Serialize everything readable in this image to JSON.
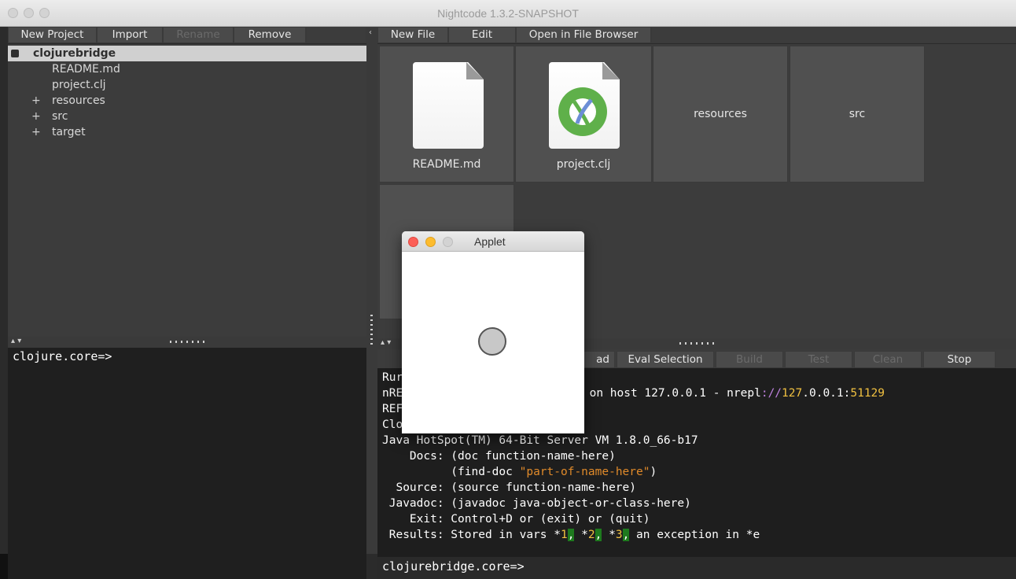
{
  "window": {
    "title": "Nightcode 1.3.2-SNAPSHOT"
  },
  "project_toolbar": {
    "new_project": "New Project",
    "import": "Import",
    "rename": "Rename",
    "remove": "Remove"
  },
  "file_toolbar": {
    "new_file": "New File",
    "edit": "Edit",
    "open_in_file_browser": "Open in File Browser"
  },
  "tree": {
    "root": "clojurebridge",
    "items": [
      "README.md",
      "project.clj",
      "resources",
      "src",
      "target"
    ],
    "expander": "+"
  },
  "grid": {
    "tiles": [
      "README.md",
      "project.clj",
      "resources",
      "src"
    ]
  },
  "splitter": {
    "collapse_arrow": "‹",
    "updown": "▴ ▾"
  },
  "left_repl": {
    "prompt": "clojure.core=>"
  },
  "repl_toolbar": {
    "reload": "ad",
    "eval_selection": "Eval Selection",
    "build": "Build",
    "test": "Test",
    "clean": "Clean",
    "stop": "Stop"
  },
  "console": {
    "run_line": "Rur",
    "nrepl_prefix": "nRE",
    "nrepl_port": "51129",
    "nrepl_host_text": " on host 127.0.0.1 - nrepl",
    "nrepl_colon": ":",
    "nrepl_slashes": "//",
    "nrepl_ip": "127",
    "nrepl_ip_rest": ".0.0.1:",
    "nrepl_port2": "51129",
    "repl_prefix": "REF",
    "clojure_prefix": "Clo",
    "java_line": "Java HotSpot(TM) 64-Bit Server VM 1.8.0_66-b17",
    "docs_line": "    Docs: (doc function-name-here)",
    "find_doc_pre": "          (find-doc ",
    "find_doc_str": "\"part-of-name-here\"",
    "find_doc_post": ")",
    "source_line": "  Source: (source function-name-here)",
    "javadoc_line": " Javadoc: (javadoc java-object-or-class-here)",
    "exit_line": "    Exit: Control+D or (exit) or (quit)",
    "results_pre": " Results: Stored in vars *",
    "r1": "1",
    "comma1": ",",
    "r2_pre": " *",
    "r2": "2",
    "comma2": ",",
    "r3_pre": " *",
    "r3": "3",
    "comma3": ",",
    "results_post": " an exception in *e",
    "prompt": "clojurebridge.core=>"
  },
  "applet": {
    "title": "Applet"
  },
  "colors": {
    "number": "#f0c040",
    "string": "#e08a2a",
    "highlight": "#1e7a1e",
    "close": "#fc5f57",
    "minimize": "#fdbc2e"
  }
}
